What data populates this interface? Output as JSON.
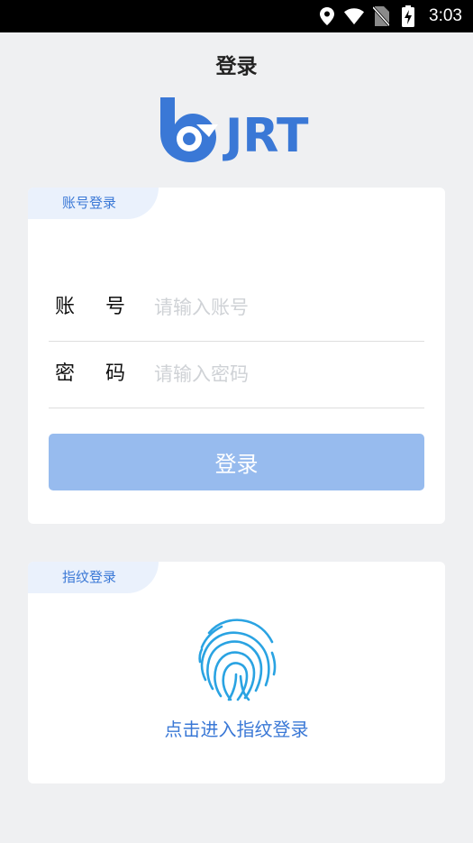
{
  "status_bar": {
    "time": "3:03",
    "icons": [
      "location-icon",
      "wifi-icon",
      "no-sim-icon",
      "battery-charging-icon"
    ]
  },
  "header": {
    "title": "登录"
  },
  "logo": {
    "text": "JRT",
    "color": "#3a78d6"
  },
  "account_login": {
    "tab_label": "账号登录",
    "account_label_1": "账",
    "account_label_2": "号",
    "account_placeholder": "请输入账号",
    "account_value": "",
    "password_label_1": "密",
    "password_label_2": "码",
    "password_placeholder": "请输入密码",
    "password_value": "",
    "login_button": "登录"
  },
  "fingerprint_login": {
    "tab_label": "指纹登录",
    "link_text": "点击进入指纹登录"
  },
  "colors": {
    "accent": "#3a78d6",
    "button_disabled": "#97bbee",
    "tab_bg": "#eaf1fc",
    "page_bg": "#eff0f2"
  }
}
